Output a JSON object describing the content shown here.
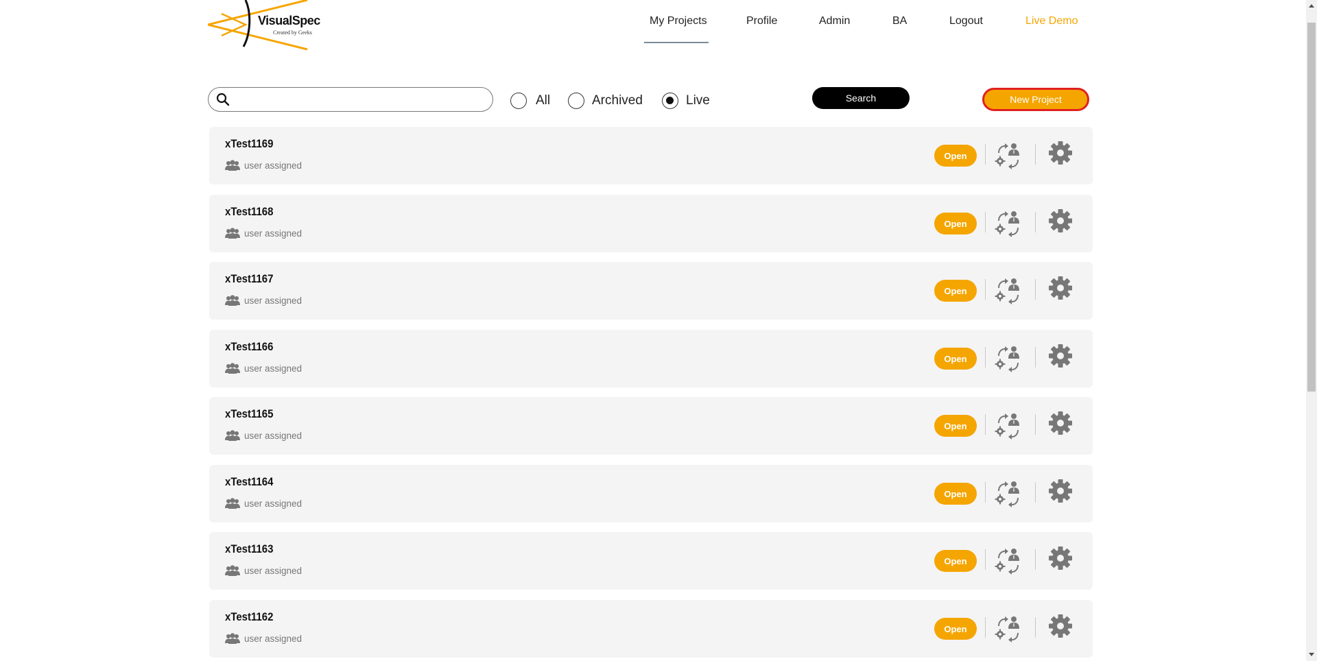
{
  "brand": {
    "name": "VisualSpec",
    "tagline": "Created by Geeks",
    "accent": "#f5a500"
  },
  "nav": {
    "my_projects": "My Projects",
    "profile": "Profile",
    "admin": "Admin",
    "ba": "BA",
    "logout": "Logout",
    "live_demo": "Live Demo"
  },
  "toolbar": {
    "search_value": "",
    "filter_all": "All",
    "filter_archived": "Archived",
    "filter_live": "Live",
    "selected_filter": "Live",
    "search_button": "Search",
    "new_project_button": "New Project"
  },
  "projects": [
    {
      "name": "xTest1169",
      "assigned": "user assigned",
      "open_label": "Open"
    },
    {
      "name": "xTest1168",
      "assigned": "user assigned",
      "open_label": "Open"
    },
    {
      "name": "xTest1167",
      "assigned": "user assigned",
      "open_label": "Open"
    },
    {
      "name": "xTest1166",
      "assigned": "user assigned",
      "open_label": "Open"
    },
    {
      "name": "xTest1165",
      "assigned": "user assigned",
      "open_label": "Open"
    },
    {
      "name": "xTest1164",
      "assigned": "user assigned",
      "open_label": "Open"
    },
    {
      "name": "xTest1163",
      "assigned": "user assigned",
      "open_label": "Open"
    },
    {
      "name": "xTest1162",
      "assigned": "user assigned",
      "open_label": "Open"
    }
  ],
  "icons": {
    "search": "search-icon",
    "users": "users-icon",
    "assign": "assign-user-icon",
    "settings": "gear-icon"
  }
}
